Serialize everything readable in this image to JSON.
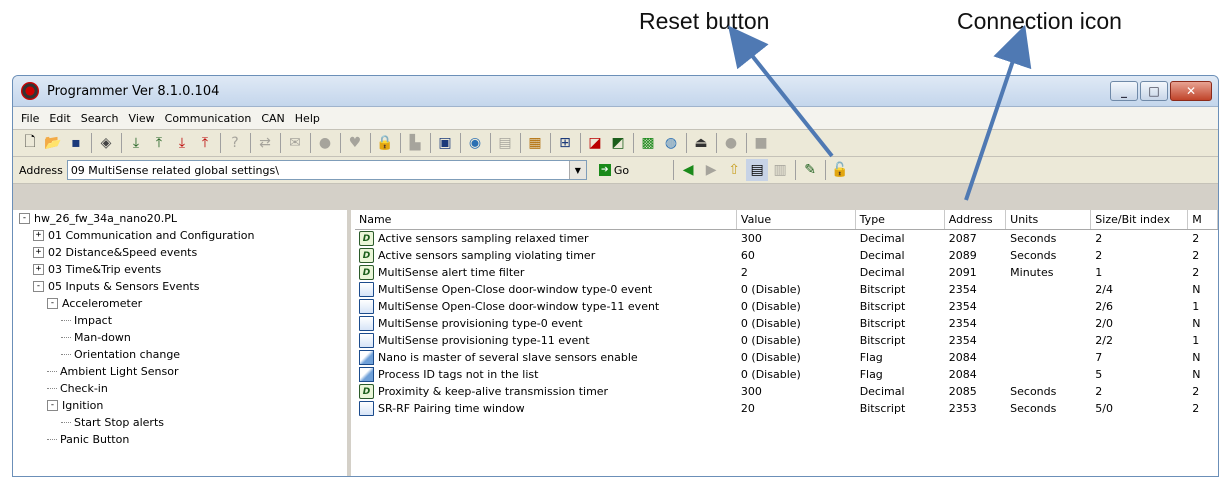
{
  "annotations": {
    "reset": "Reset button",
    "connection": "Connection icon"
  },
  "window": {
    "title": "Programmer  Ver 8.1.0.104"
  },
  "menu": [
    "File",
    "Edit",
    "Search",
    "View",
    "Communication",
    "CAN",
    "Help"
  ],
  "address": {
    "label": "Address",
    "value": "09 MultiSense related global settings\\",
    "go_label": "Go"
  },
  "tree": [
    {
      "label": "hw_26_fw_34a_nano20.PL",
      "toggle": "-",
      "depth": 0
    },
    {
      "label": "01 Communication and Configuration",
      "toggle": "+",
      "depth": 1
    },
    {
      "label": "02 Distance&Speed events",
      "toggle": "+",
      "depth": 1
    },
    {
      "label": "03 Time&Trip events",
      "toggle": "+",
      "depth": 1
    },
    {
      "label": "05 Inputs & Sensors Events",
      "toggle": "-",
      "depth": 1
    },
    {
      "label": "Accelerometer",
      "toggle": "-",
      "depth": 2
    },
    {
      "label": "Impact",
      "toggle": "",
      "depth": 3
    },
    {
      "label": "Man-down",
      "toggle": "",
      "depth": 3
    },
    {
      "label": "Orientation change",
      "toggle": "",
      "depth": 3
    },
    {
      "label": "Ambient Light Sensor",
      "toggle": "",
      "depth": 2
    },
    {
      "label": "Check-in",
      "toggle": "",
      "depth": 2
    },
    {
      "label": "Ignition",
      "toggle": "-",
      "depth": 2
    },
    {
      "label": "Start Stop alerts",
      "toggle": "",
      "depth": 3
    },
    {
      "label": "Panic Button",
      "toggle": "",
      "depth": 2
    }
  ],
  "grid": {
    "columns": [
      "Name",
      "Value",
      "Type",
      "Address",
      "Units",
      "Size/Bit index",
      "M"
    ],
    "rows": [
      {
        "icon": "decimal",
        "name": "Active sensors sampling relaxed timer",
        "value": "300",
        "type": "Decimal",
        "address": "2087",
        "units": "Seconds",
        "size": "2",
        "m": "2"
      },
      {
        "icon": "decimal",
        "name": "Active sensors sampling violating timer",
        "value": "60",
        "type": "Decimal",
        "address": "2089",
        "units": "Seconds",
        "size": "2",
        "m": "2"
      },
      {
        "icon": "decimal",
        "name": "MultiSense alert time filter",
        "value": "2",
        "type": "Decimal",
        "address": "2091",
        "units": "Minutes",
        "size": "1",
        "m": "2"
      },
      {
        "icon": "bitscript",
        "name": "MultiSense Open-Close door-window type-0 event",
        "value": "0 (Disable)",
        "type": "Bitscript",
        "address": "2354",
        "units": "",
        "size": "2/4",
        "m": "N"
      },
      {
        "icon": "bitscript",
        "name": "MultiSense Open-Close door-window type-11 event",
        "value": "0 (Disable)",
        "type": "Bitscript",
        "address": "2354",
        "units": "",
        "size": "2/6",
        "m": "1"
      },
      {
        "icon": "bitscript",
        "name": "MultiSense provisioning type-0 event",
        "value": "0 (Disable)",
        "type": "Bitscript",
        "address": "2354",
        "units": "",
        "size": "2/0",
        "m": "N"
      },
      {
        "icon": "bitscript",
        "name": "MultiSense provisioning type-11 event",
        "value": "0 (Disable)",
        "type": "Bitscript",
        "address": "2354",
        "units": "",
        "size": "2/2",
        "m": "1"
      },
      {
        "icon": "flag",
        "name": "Nano is master of several slave sensors enable",
        "value": "0 (Disable)",
        "type": "Flag",
        "address": "2084",
        "units": "",
        "size": "7",
        "m": "N"
      },
      {
        "icon": "flag",
        "name": "Process ID tags not in the list",
        "value": "0 (Disable)",
        "type": "Flag",
        "address": "2084",
        "units": "",
        "size": "5",
        "m": "N"
      },
      {
        "icon": "decimal",
        "name": "Proximity & keep-alive transmission timer",
        "value": "300",
        "type": "Decimal",
        "address": "2085",
        "units": "Seconds",
        "size": "2",
        "m": "2"
      },
      {
        "icon": "bitscript",
        "name": "SR-RF Pairing time window",
        "value": "20",
        "type": "Bitscript",
        "address": "2353",
        "units": "Seconds",
        "size": "5/0",
        "m": "2"
      }
    ]
  },
  "toolbar_icons": [
    "new-file-icon",
    "open-folder-icon",
    "save-icon",
    "chip-icon",
    "download-icon",
    "upload-icon",
    "download-red-icon",
    "upload-red-icon",
    "help-icon",
    "refresh-icon",
    "send-icon",
    "stop-icon",
    "heart-icon",
    "lock-icon",
    "graph-icon",
    "monitor-icon",
    "globe-icon",
    "calc-icon",
    "schedule-icon",
    "grid-icon",
    "chart-icon",
    "chart-alt-icon",
    "reset-icon",
    "network-icon",
    "can-icon",
    "record-icon",
    "pause-icon"
  ]
}
